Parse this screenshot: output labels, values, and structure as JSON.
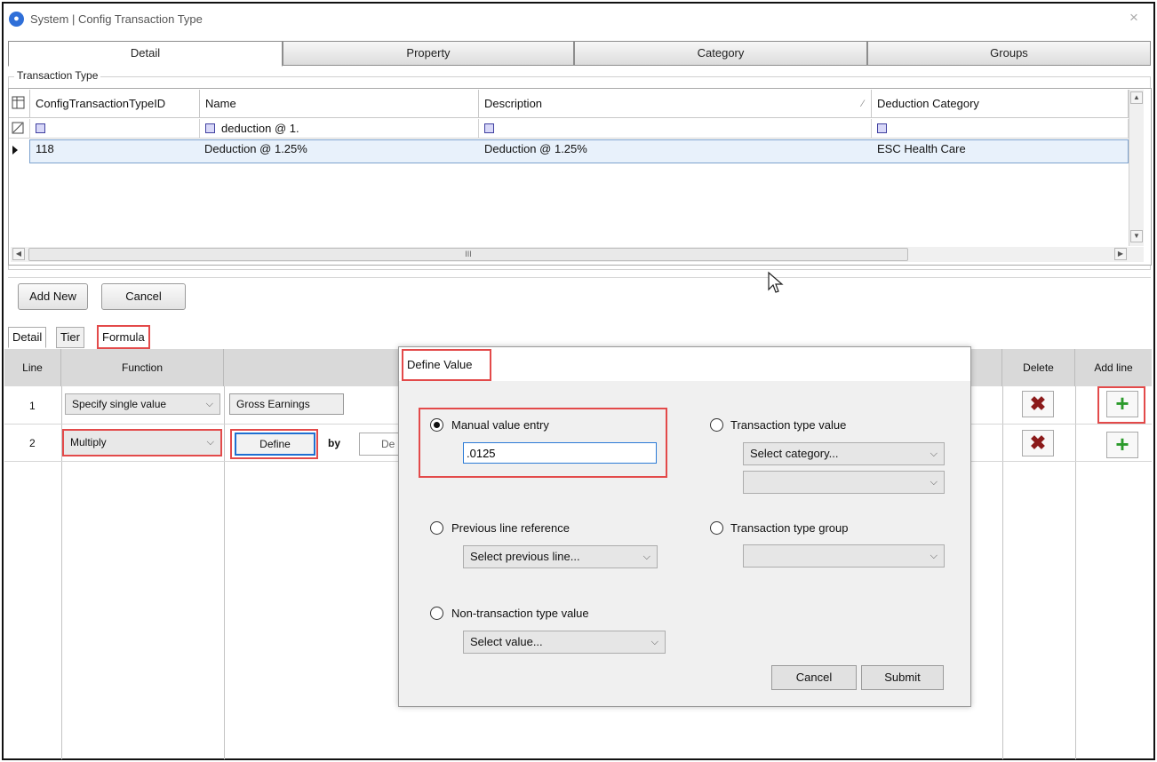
{
  "window": {
    "title": "System | Config Transaction Type",
    "app_icon": "transaction-app-icon",
    "close": "×"
  },
  "top_tabs": [
    "Detail",
    "Property",
    "Category",
    "Groups"
  ],
  "transaction_type": {
    "group_label": "Transaction Type",
    "columns": [
      "ConfigTransactionTypeID",
      "Name",
      "Description",
      "Deduction Category"
    ],
    "filters": [
      "",
      "deduction @ 1.",
      "",
      ""
    ],
    "rows": [
      {
        "id": "118",
        "name": "Deduction @ 1.25%",
        "description": "Deduction @ 1.25%",
        "category": "ESC Health Care"
      }
    ],
    "hscroll_grip": "III"
  },
  "buttons": {
    "add_new": "Add New",
    "cancel": "Cancel"
  },
  "sub_tabs": [
    "Detail",
    "Tier",
    "Formula"
  ],
  "formula": {
    "headers": {
      "line": "Line",
      "function": "Function",
      "delete": "Delete",
      "add_line": "Add line"
    },
    "lines": [
      {
        "line": "1",
        "function": "Specify single value",
        "value": "Gross Earnings"
      },
      {
        "line": "2",
        "function": "Multiply",
        "define": "Define",
        "by": "by",
        "right_field": "De"
      }
    ]
  },
  "dialog": {
    "title": "Define Value",
    "manual": {
      "label": "Manual value entry",
      "value": ".0125",
      "selected": true
    },
    "transaction_type_value": {
      "label": "Transaction type value",
      "category_placeholder": "Select category...",
      "second": ""
    },
    "previous_line": {
      "label": "Previous line reference",
      "placeholder": "Select previous line..."
    },
    "transaction_type_group": {
      "label": "Transaction type group",
      "value": ""
    },
    "non_transaction": {
      "label": "Non-transaction type value",
      "placeholder": "Select value..."
    },
    "cancel": "Cancel",
    "submit": "Submit"
  },
  "colors": {
    "highlight": "#e34a4a",
    "selected_row": "#e8f1fb",
    "delete": "#8b1a1a",
    "add": "#2b9a2b"
  }
}
